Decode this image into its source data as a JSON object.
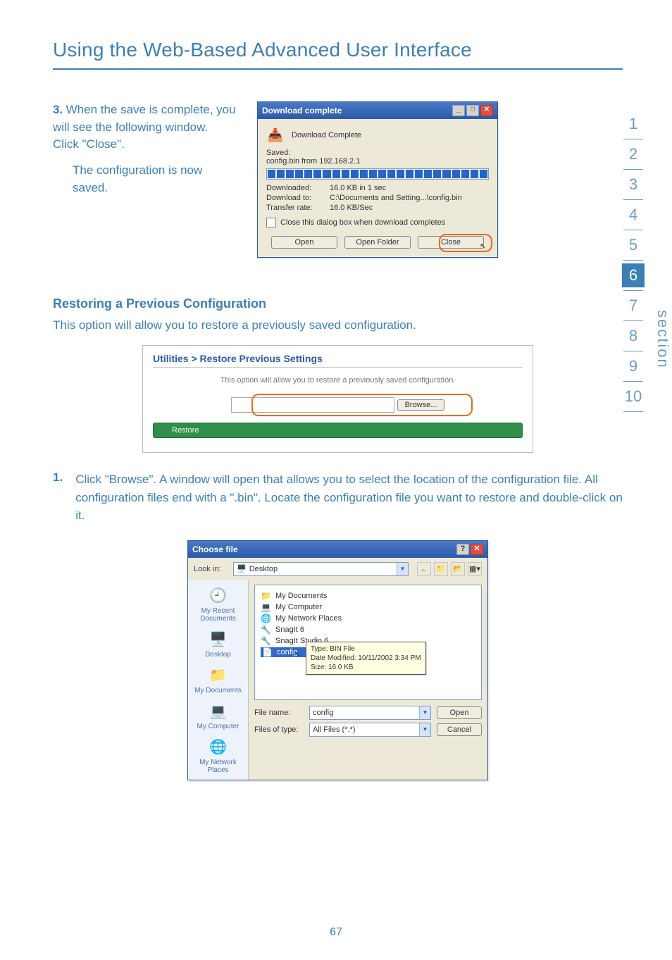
{
  "page": {
    "title": "Using the Web-Based Advanced User Interface",
    "number": "67"
  },
  "step3": {
    "num": "3.",
    "p1": "When the save is complete, you will see the following window. Click \"Close\".",
    "p2": "The configuration is now saved."
  },
  "dl": {
    "title": "Download complete",
    "subtitle": "Download Complete",
    "savedLabel": "Saved:",
    "savedValue": "config.bin from 192.168.2.1",
    "downloadedK": "Downloaded:",
    "downloadedV": "16.0 KB in 1 sec",
    "downloadToK": "Download to:",
    "downloadToV": "C:\\Documents and Setting...\\config.bin",
    "transferK": "Transfer rate:",
    "transferV": "16.0 KB/Sec",
    "checkbox": "Close this dialog box when download completes",
    "btnOpen": "Open",
    "btnFolder": "Open Folder",
    "btnClose": "Close"
  },
  "restore": {
    "heading": "Restoring a Previous Configuration",
    "lead": "This option will allow you to restore a previously saved configuration.",
    "boxTitle": "Utilities > Restore Previous Settings",
    "boxDesc": "This option will allow you to restore a previously saved configuration.",
    "browse": "Browse...",
    "restoreBtn": "Restore"
  },
  "step1": {
    "num": "1.",
    "txt": "Click \"Browse\". A window will open that allows you to select the location of the configuration file. All configuration files end with a \".bin\". Locate the configuration file you want to restore and double-click on it."
  },
  "open": {
    "title": "Choose file",
    "lookIn": "Look in:",
    "dropdown": "Desktop",
    "places": {
      "recent": "My Recent Documents",
      "desktop": "Desktop",
      "mydocs": "My Documents",
      "mycomp": "My Computer",
      "mynet": "My Network Places"
    },
    "items": {
      "mydocuments": "My Documents",
      "mycomputer": "My Computer",
      "mynetplaces": "My Network Places",
      "snagit6": "SnagIt 6",
      "snagitstudio": "SnagIt Studio 6",
      "config": "config"
    },
    "tooltip": {
      "l1": "Type: BIN File",
      "l2": "Date Modified: 10/11/2002 3:34 PM",
      "l3": "Size: 16.0 KB"
    },
    "fileNameLbl": "File name:",
    "fileNameVal": "config",
    "fileTypeLbl": "Files of type:",
    "fileTypeVal": "All Files (*.*)",
    "openBtn": "Open",
    "cancelBtn": "Cancel"
  },
  "nav": {
    "n1": "1",
    "n2": "2",
    "n3": "3",
    "n4": "4",
    "n5": "5",
    "n6": "6",
    "n7": "7",
    "n8": "8",
    "n9": "9",
    "n10": "10",
    "label": "section"
  }
}
